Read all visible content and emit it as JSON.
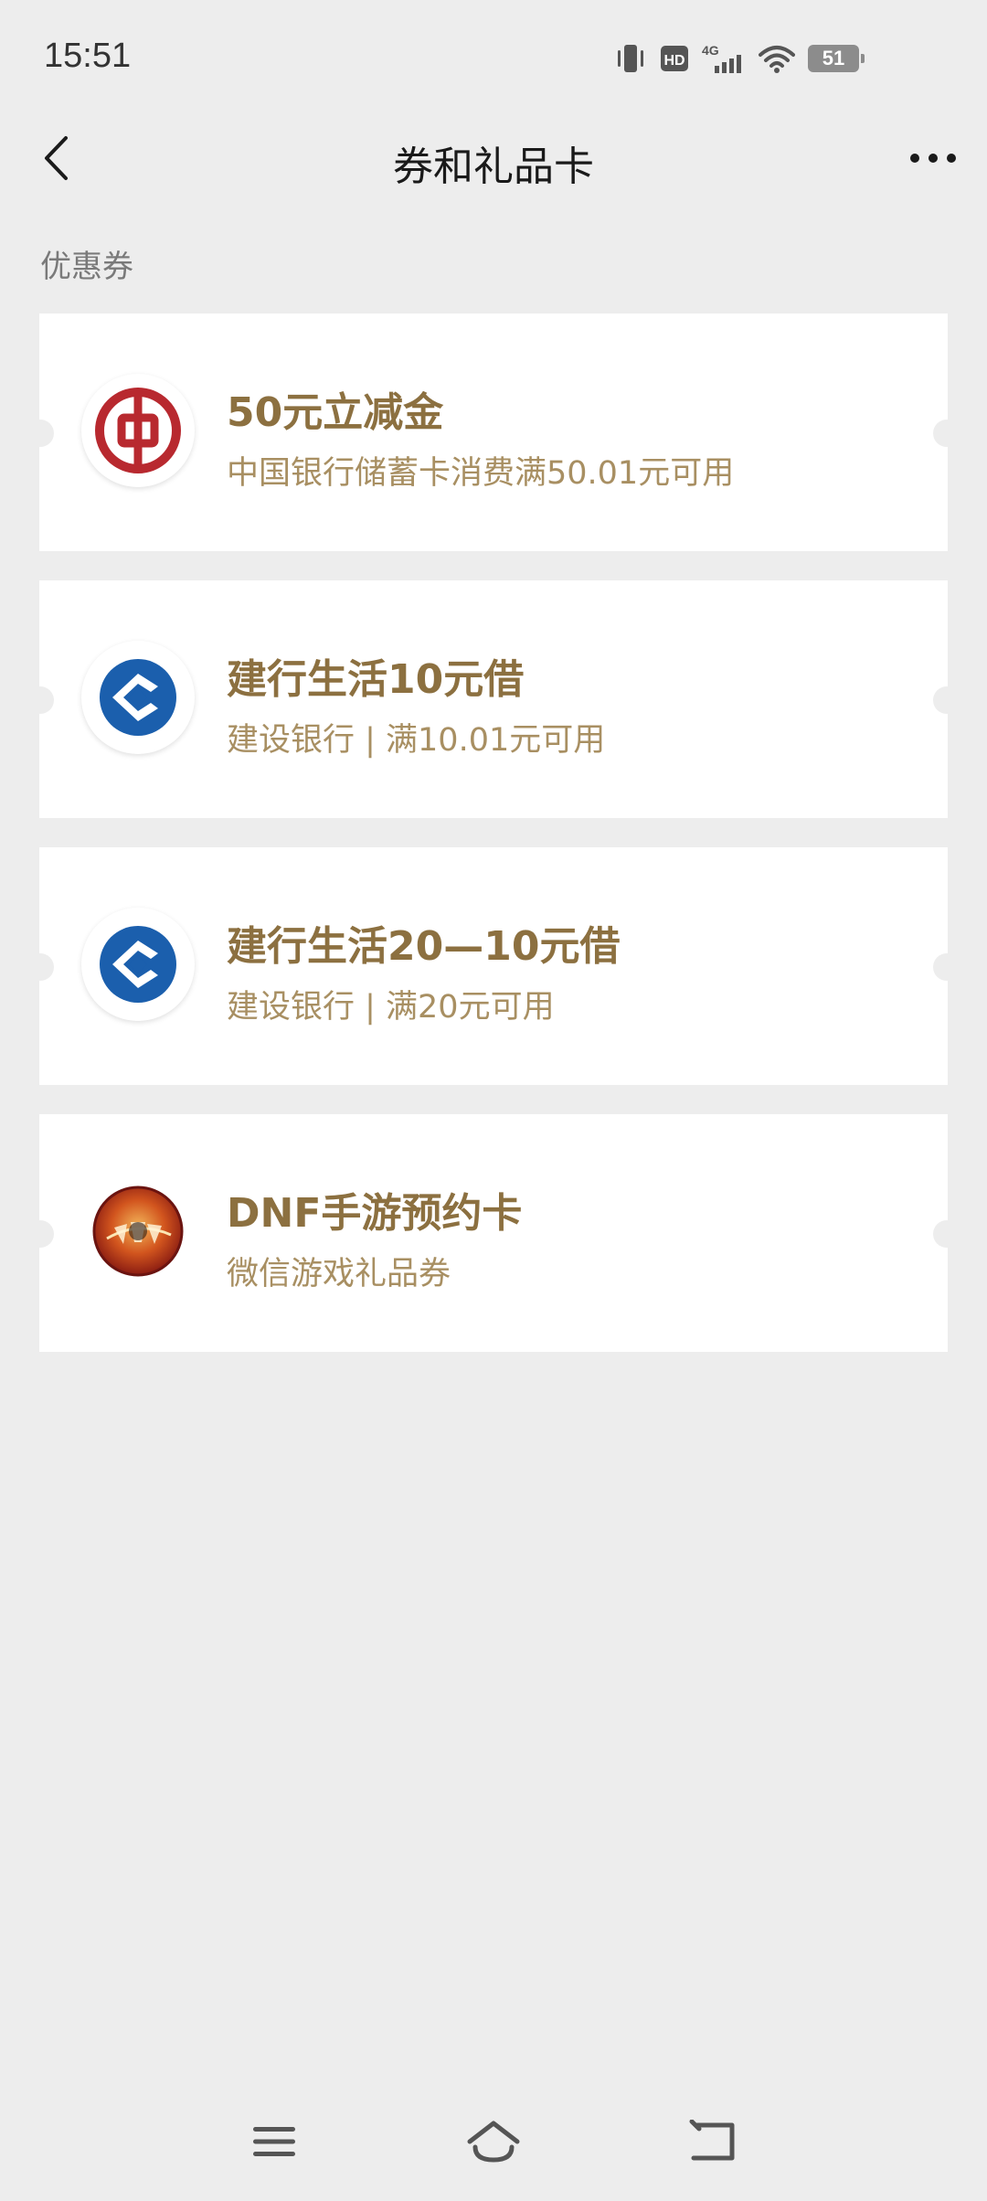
{
  "status_bar": {
    "time": "15:51",
    "network": "4G",
    "hd": "HD",
    "battery": "51",
    "icons": [
      "vibrate-icon",
      "hd-icon",
      "signal-4g-icon",
      "wifi-icon",
      "battery-icon"
    ]
  },
  "header": {
    "title": "券和礼品卡",
    "back_icon": "chevron-left-icon",
    "more_icon": "more-horizontal-icon"
  },
  "section": {
    "label": "优惠券"
  },
  "coupons": [
    {
      "title": "50元立减金",
      "subtitle": "中国银行储蓄卡消费满50.01元可用",
      "logo": "boc-logo-icon"
    },
    {
      "title": "建行生活10元借",
      "subtitle": "建设银行 | 满10.01元可用",
      "logo": "ccb-logo-icon"
    },
    {
      "title": "建行生活20—10元借",
      "subtitle": "建设银行 | 满20元可用",
      "logo": "ccb-logo-icon"
    },
    {
      "title": "DNF手游预约卡",
      "subtitle": "微信游戏礼品券",
      "logo": "dnf-logo-icon"
    }
  ],
  "colors": {
    "background": "#ededed",
    "card": "#ffffff",
    "title_gold": "#8c7040",
    "subtitle_gold": "#a88f62",
    "boc_red": "#b8292f",
    "ccb_blue": "#1b5fad"
  },
  "system_nav": {
    "icons": [
      "menu-icon",
      "home-icon",
      "back-icon"
    ]
  }
}
